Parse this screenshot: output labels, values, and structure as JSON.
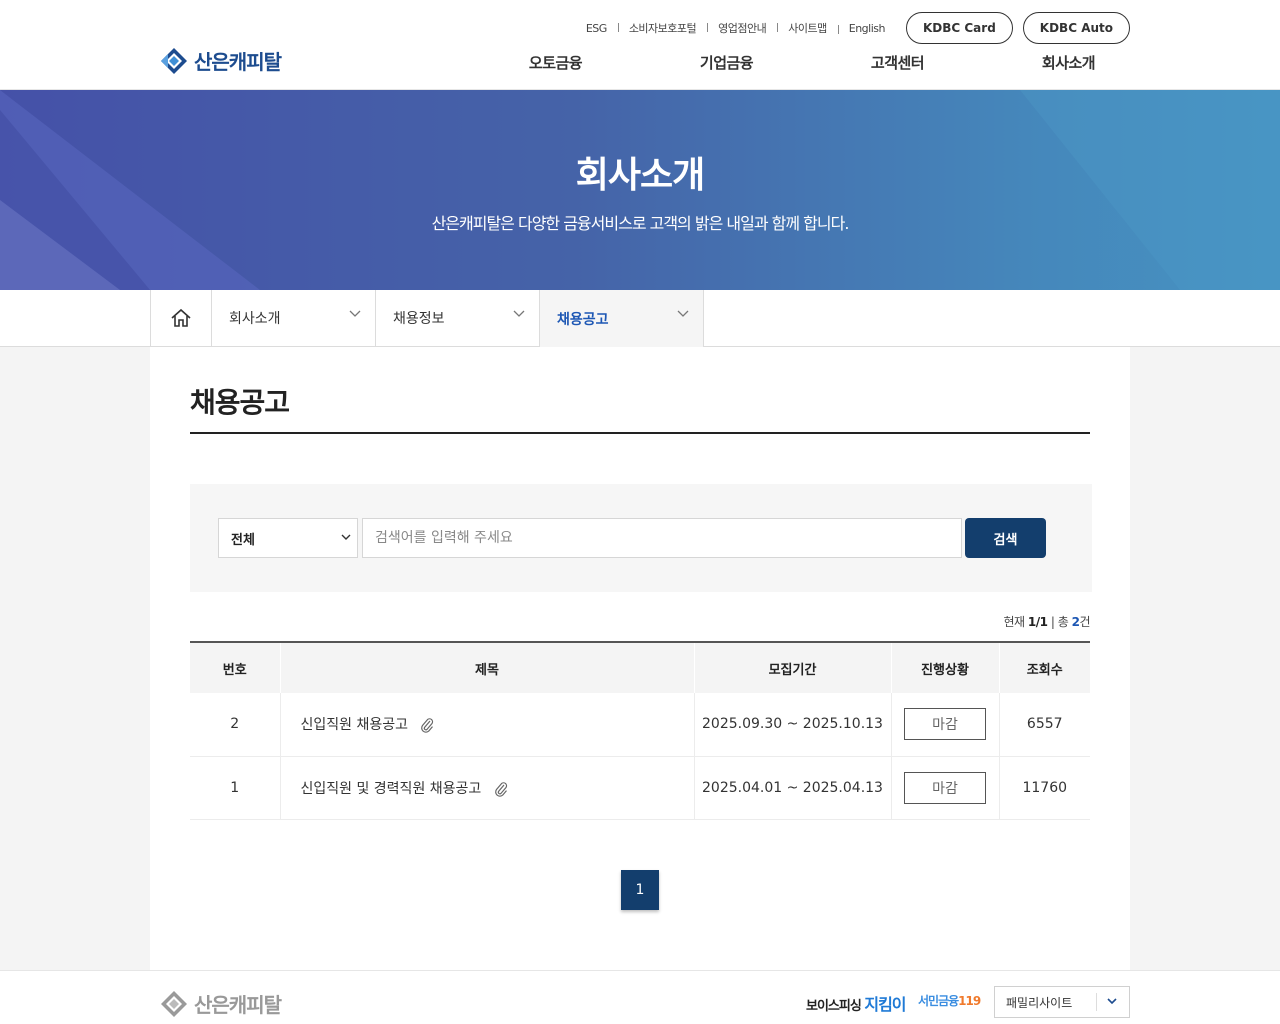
{
  "header": {
    "logo_text": "산은캐피탈",
    "util_links": [
      "ESG",
      "소비자보호포털",
      "영업점안내",
      "사이트맵",
      "English"
    ],
    "pill_buttons": [
      "KDBC Card",
      "KDBC Auto"
    ],
    "gnb": [
      "오토금융",
      "기업금융",
      "고객센터",
      "회사소개"
    ]
  },
  "hero": {
    "title": "회사소개",
    "subtitle": "산은캐피탈은 다양한 금융서비스로 고객의 밝은 내일과 함께 합니다."
  },
  "breadcrumb": {
    "items": [
      "회사소개",
      "채용정보",
      "채용공고"
    ]
  },
  "page": {
    "title": "채용공고"
  },
  "search": {
    "select_value": "전체",
    "placeholder": "검색어를 입력해 주세요",
    "button": "검색"
  },
  "count": {
    "label_current": "현재",
    "current": "1/1",
    "label_total": "총",
    "total": "2",
    "unit": "건"
  },
  "table": {
    "headers": [
      "번호",
      "제목",
      "모집기간",
      "진행상황",
      "조회수"
    ],
    "rows": [
      {
        "no": "2",
        "title": "신입직원 채용공고",
        "period": "2025.09.30 ~ 2025.10.13",
        "status": "마감",
        "views": "6557"
      },
      {
        "no": "1",
        "title": "신입직원 및 경력직원 채용공고",
        "period": "2025.04.01 ~ 2025.04.13",
        "status": "마감",
        "views": "11760"
      }
    ]
  },
  "pagination": {
    "current": "1"
  },
  "footer": {
    "logo_text": "산은캐피탈",
    "voice_prefix": "보이스피싱",
    "voice_highlight": "지킴이",
    "finance_prefix": "서민금융",
    "finance_num": "119",
    "family_site": "패밀리사이트"
  },
  "colors": {
    "brand_blue": "#1d4c8f",
    "button_navy": "#133e6d",
    "active_blue": "#1d57b4"
  }
}
